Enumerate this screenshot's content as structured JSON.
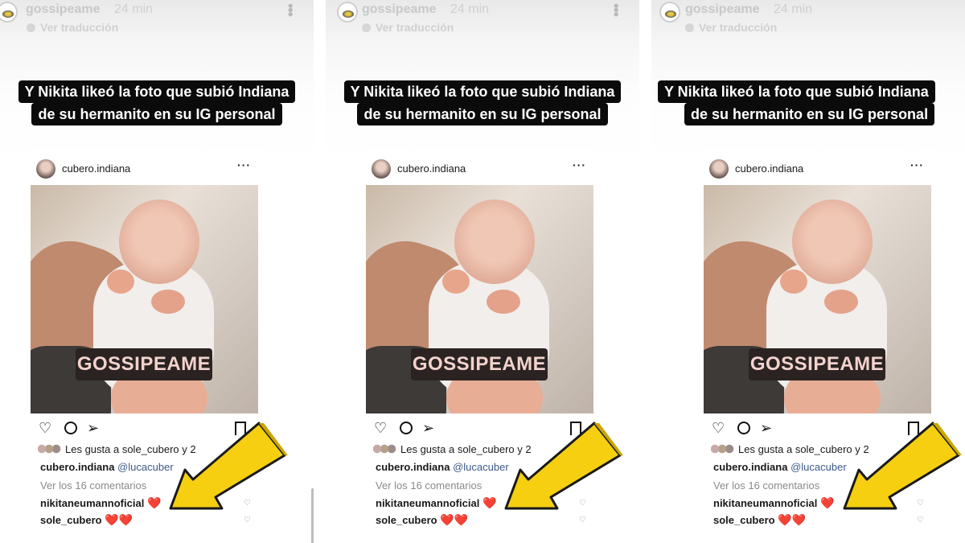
{
  "story": {
    "username": "gossipeame",
    "time": "24 min",
    "translation_label": "Ver traducción",
    "caption_line1": "Y Nikita likeó la foto que subió Indiana",
    "caption_line2": "de su hermanito en su IG personal"
  },
  "post": {
    "username": "cubero.indiana",
    "more_label": "···",
    "watermark": "GOSSIPEAME",
    "likes_text": "Les gusta a sole_cubero y 2",
    "caption_user": "cubero.indiana",
    "caption_mention": "@lucacuber",
    "view_comments": "Ver los 16 comentarios",
    "comments": [
      {
        "user": "nikitaneumannoficial",
        "emoji": "❤️"
      },
      {
        "user": "sole_cubero",
        "emoji": "❤️❤️"
      }
    ]
  },
  "panels": [
    {
      "id": "panel-1"
    },
    {
      "id": "panel-2"
    },
    {
      "id": "panel-3"
    }
  ],
  "colors": {
    "caption_bg": "#0b0b0b",
    "arrow_fill": "#f5cf10",
    "arrow_stroke": "#1a1a1a",
    "heart": "#e0102a"
  }
}
